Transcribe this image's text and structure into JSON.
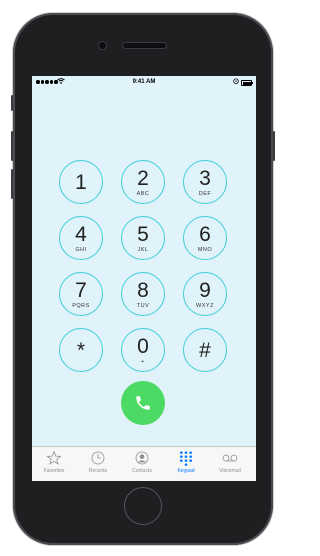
{
  "status_bar": {
    "time": "9:41 AM"
  },
  "keypad": [
    {
      "digit": "1",
      "letters": ""
    },
    {
      "digit": "2",
      "letters": "ABC"
    },
    {
      "digit": "3",
      "letters": "DEF"
    },
    {
      "digit": "4",
      "letters": "GHI"
    },
    {
      "digit": "5",
      "letters": "JKL"
    },
    {
      "digit": "6",
      "letters": "MNO"
    },
    {
      "digit": "7",
      "letters": "PQRS"
    },
    {
      "digit": "8",
      "letters": "TUV"
    },
    {
      "digit": "9",
      "letters": "WXYZ"
    },
    {
      "digit": "*",
      "letters": ""
    },
    {
      "digit": "0",
      "letters": "+"
    },
    {
      "digit": "#",
      "letters": ""
    }
  ],
  "tabs": [
    {
      "label": "Favorites",
      "icon": "star-icon"
    },
    {
      "label": "Recents",
      "icon": "clock-icon"
    },
    {
      "label": "Contacts",
      "icon": "contact-icon"
    },
    {
      "label": "Keypad",
      "icon": "keypad-icon",
      "active": true
    },
    {
      "label": "Voicemail",
      "icon": "voicemail-icon"
    }
  ],
  "colors": {
    "key_ring": "#3fcfd6",
    "call": "#4cd964",
    "active_tab": "#0a7afe",
    "screen_bg": "#e1f3fa"
  }
}
